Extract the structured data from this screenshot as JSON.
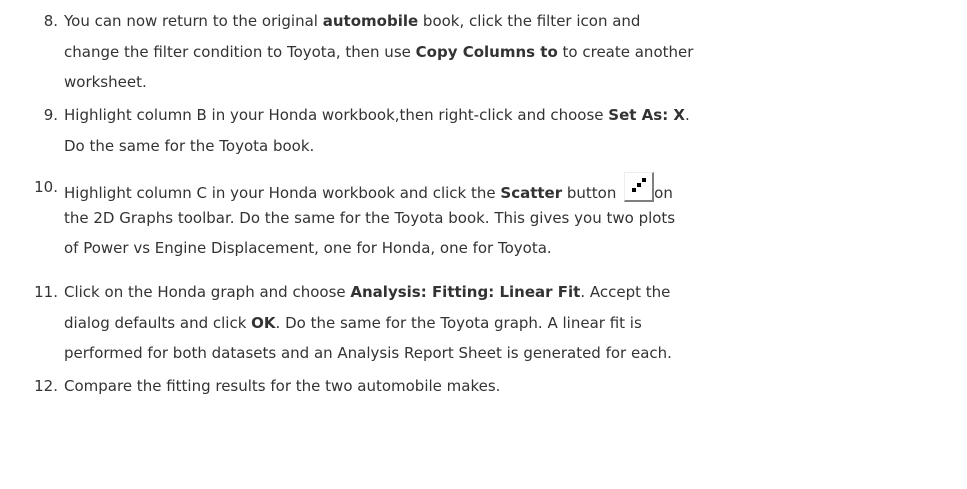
{
  "steps": [
    {
      "number": "8.",
      "lines": [
        [
          "You can now return to the original ",
          "automobile",
          " book, click the filter icon and"
        ],
        [
          "change the filter condition to Toyota, then use ",
          "Copy Columns to",
          " to create another"
        ],
        [
          "worksheet."
        ]
      ]
    },
    {
      "number": "9.",
      "lines": [
        [
          "Highlight column B in your Honda workbook,then right-click and choose ",
          "Set As: X",
          "."
        ],
        [
          "Do the same for the Toyota book."
        ]
      ]
    },
    {
      "number": "10.",
      "lines": [
        [
          "Highlight column C in your Honda workbook and click the ",
          "Scatter",
          " button ",
          "on"
        ],
        [
          "the 2D Graphs toolbar. Do the same for the Toyota book. This gives you two plots"
        ],
        [
          "of Power vs Engine Displacement, one for Honda, one for Toyota."
        ]
      ]
    },
    {
      "number": "11.",
      "lines": [
        [
          "Click on the Honda graph and choose ",
          "Analysis: Fitting: Linear Fit",
          ". Accept the"
        ],
        [
          "dialog defaults and click ",
          "OK",
          ". Do the same for the Toyota graph. A linear fit is"
        ],
        [
          "performed for both datasets and an Analysis Report Sheet is generated for each."
        ]
      ]
    },
    {
      "number": "12.",
      "lines": [
        [
          "Compare the fitting results for the two automobile makes."
        ]
      ]
    }
  ],
  "icons": {
    "scatter_button": "scatter-plot-icon"
  }
}
